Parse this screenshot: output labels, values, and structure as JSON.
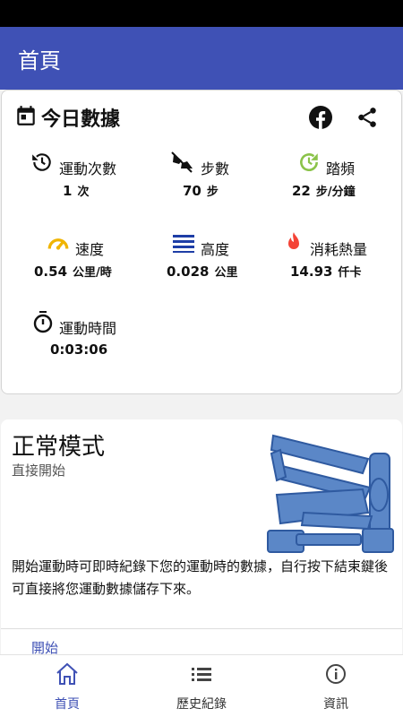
{
  "app_bar": {
    "title": "首頁"
  },
  "today": {
    "title": "今日數據",
    "header_icons": [
      "calendar-icon",
      "facebook-icon",
      "share-icon"
    ],
    "stats": [
      {
        "icon": "history-icon",
        "label": "運動次數",
        "value": "1",
        "unit": "次",
        "color": "#000000"
      },
      {
        "icon": "steps-icon",
        "label": "步數",
        "value": "70",
        "unit": "步",
        "color": "#000000"
      },
      {
        "icon": "cadence-icon",
        "label": "踏頻",
        "value": "22",
        "unit": "步/分鐘",
        "color": "#8bc34a"
      },
      {
        "icon": "speedometer-icon",
        "label": "速度",
        "value": "0.54",
        "unit": "公里/時",
        "color": "#f0b400"
      },
      {
        "icon": "height-icon",
        "label": "高度",
        "value": "0.028",
        "unit": "公里",
        "color": "#1e3ea6"
      },
      {
        "icon": "flame-icon",
        "label": "消耗熱量",
        "value": "14.93",
        "unit": "仟卡",
        "color": "#f44336"
      },
      {
        "icon": "timer-icon",
        "label": "運動時間",
        "value": "0:03:06",
        "unit": "",
        "color": "#000000"
      }
    ]
  },
  "mode": {
    "title": "正常模式",
    "subtitle": "直接開始",
    "description": "開始運動時可即時紀錄下您的運動時的數據，自行按下結束鍵後可直接將您運動數據儲存下來。",
    "start_label": "開始",
    "image_icon": "stepper-machine-icon",
    "accent": "#3f51b5"
  },
  "bottom_nav": [
    {
      "label": "首頁",
      "icon": "home-icon",
      "active": true
    },
    {
      "label": "歷史紀錄",
      "icon": "list-icon",
      "active": false
    },
    {
      "label": "資訊",
      "icon": "info-icon",
      "active": false
    }
  ]
}
